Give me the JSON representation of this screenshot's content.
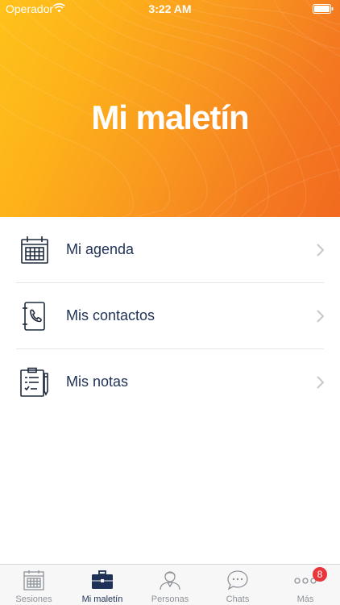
{
  "status_bar": {
    "carrier": "Operador",
    "time": "3:22 AM"
  },
  "header": {
    "title": "Mi maletín"
  },
  "menu": {
    "items": [
      {
        "label": "Mi agenda",
        "icon": "calendar-icon"
      },
      {
        "label": "Mis contactos",
        "icon": "contact-book-icon"
      },
      {
        "label": "Mis notas",
        "icon": "notes-clipboard-icon"
      }
    ]
  },
  "tab_bar": {
    "tabs": [
      {
        "label": "Sesiones",
        "icon": "calendar-icon"
      },
      {
        "label": "Mi maletín",
        "icon": "briefcase-icon",
        "active": true
      },
      {
        "label": "Personas",
        "icon": "person-icon"
      },
      {
        "label": "Chats",
        "icon": "chat-bubble-icon"
      },
      {
        "label": "Más",
        "icon": "more-dots-icon"
      }
    ],
    "more_badge": "8"
  },
  "colors": {
    "gradient_start": "#ffc21a",
    "gradient_end": "#f26a1f",
    "text_primary": "#1f3157",
    "tab_inactive": "#8e9399",
    "badge": "#e8363a"
  }
}
